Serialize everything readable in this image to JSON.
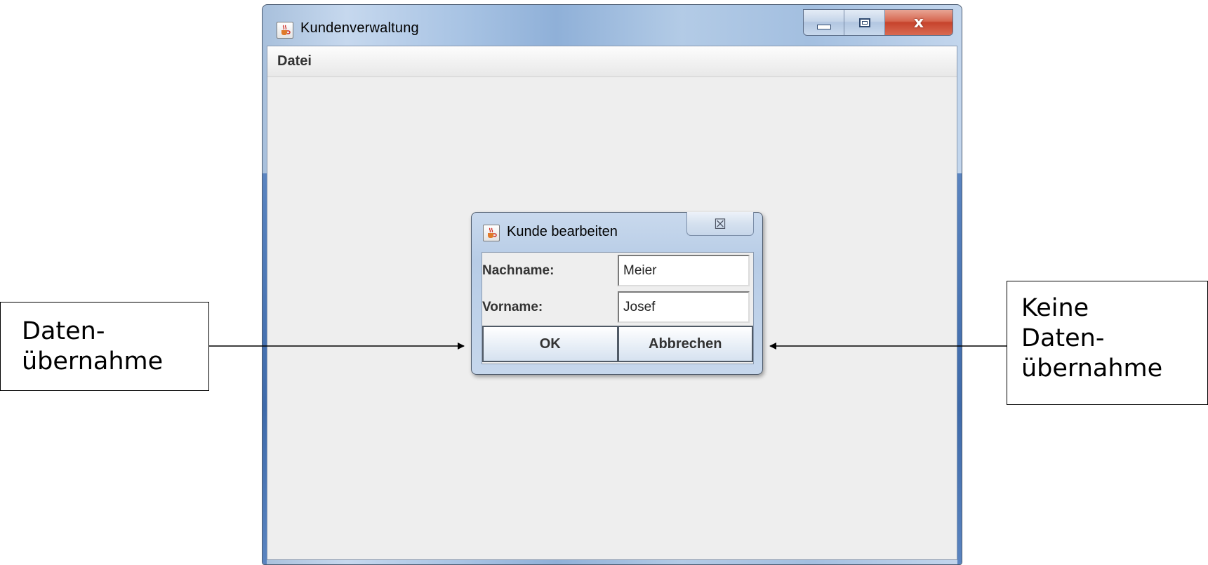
{
  "main_window": {
    "title": "Kundenverwaltung",
    "icon": "java-coffee-cup-icon",
    "menu": [
      "Datei"
    ],
    "caption_buttons": {
      "minimize": "minimize-icon",
      "maximize": "maximize-icon",
      "close": "x"
    }
  },
  "dialog": {
    "title": "Kunde bearbeiten",
    "icon": "java-coffee-cup-icon",
    "close_glyph": "☒",
    "fields": [
      {
        "label": "Nachname:",
        "value": "Meier"
      },
      {
        "label": "Vorname:",
        "value": "Josef"
      }
    ],
    "buttons": {
      "ok": "OK",
      "cancel": "Abbrechen"
    }
  },
  "annotations": {
    "left": [
      "Daten-",
      "übernahme"
    ],
    "right": [
      "Keine",
      "Daten-",
      "übernahme"
    ]
  },
  "colors": {
    "client_background": "#eeeeee",
    "title_gradient": "#a9c4e4",
    "close_button": "#c6432c"
  }
}
